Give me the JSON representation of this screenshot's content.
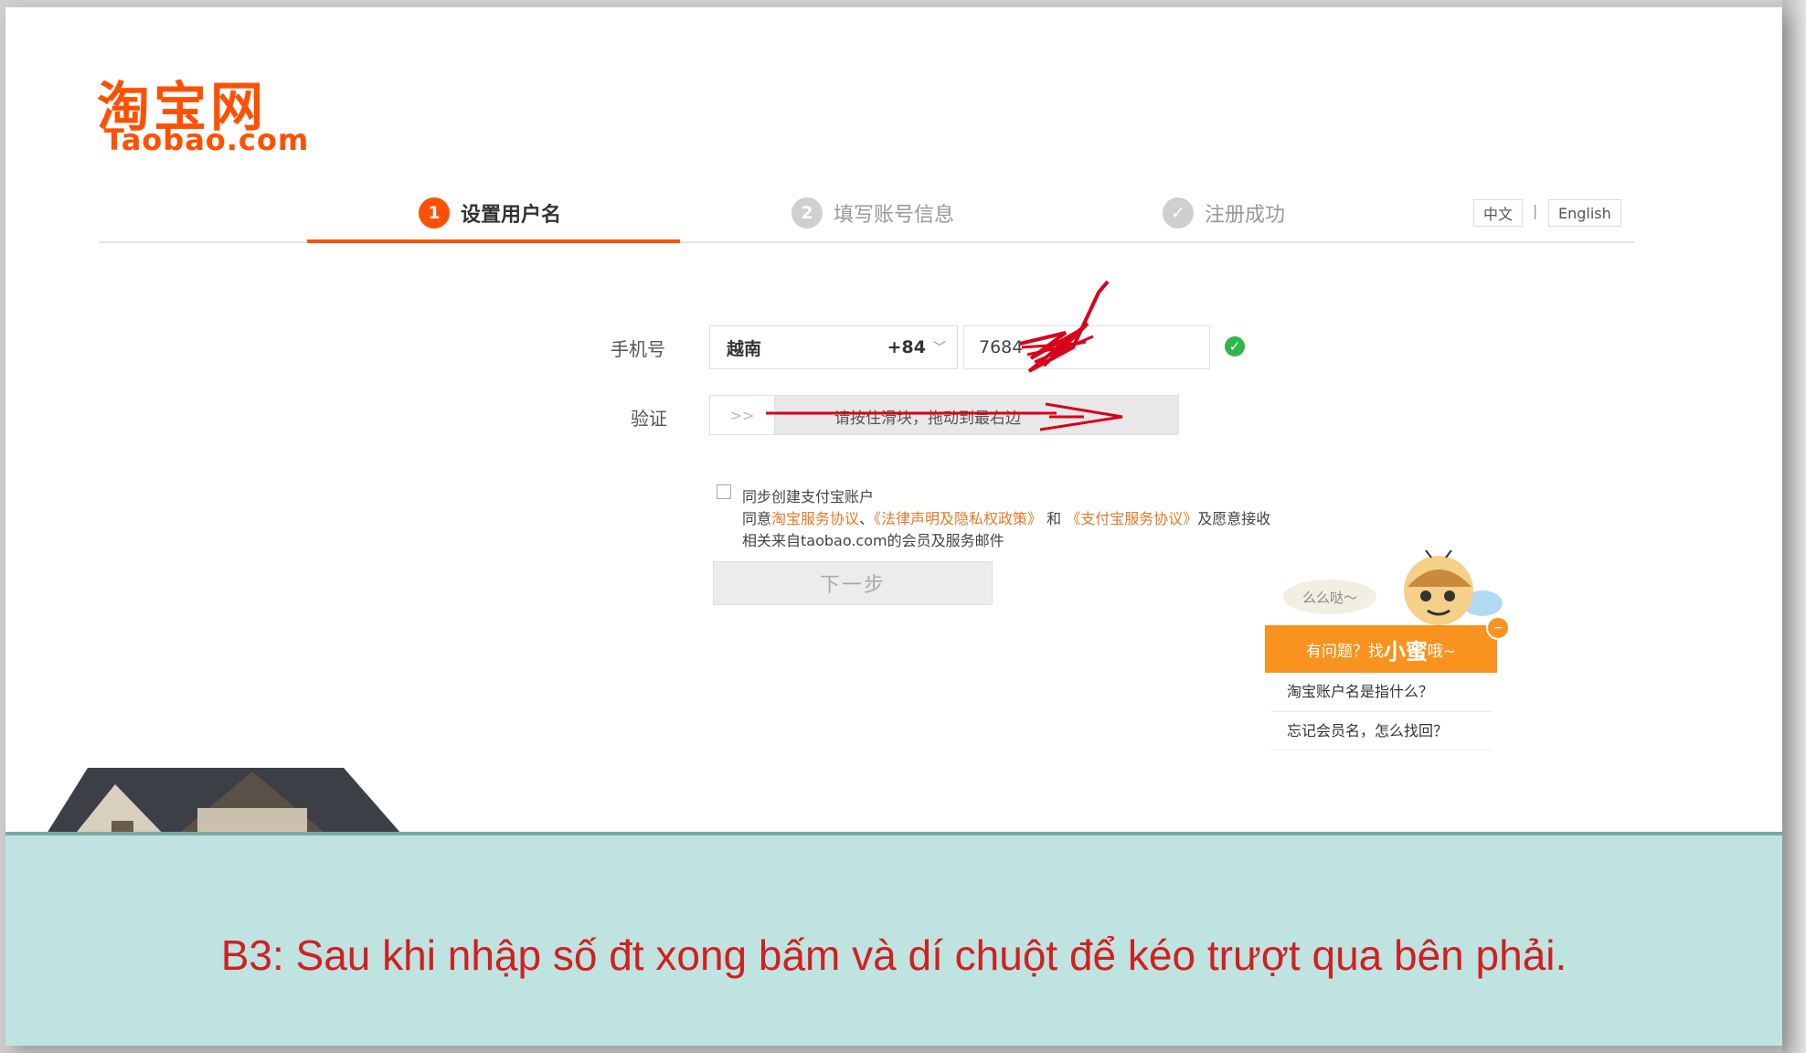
{
  "logo": {
    "chinese": "淘宝网",
    "english": "Taobao.com"
  },
  "steps": [
    {
      "number": "1",
      "label": "设置用户名",
      "active": true
    },
    {
      "number": "2",
      "label": "填写账号信息",
      "active": false
    },
    {
      "number": "✓",
      "label": "注册成功",
      "active": false
    }
  ],
  "language": {
    "chinese": "中文",
    "separator": "|",
    "english": "English"
  },
  "form": {
    "phone_label": "手机号",
    "country_name": "越南",
    "country_code": "+84",
    "phone_value": "7684",
    "verify_label": "验证",
    "slider_handle": ">>",
    "slider_text": "请按住滑块，拖动到最右边",
    "checkbox_label": "同步创建支付宝账户",
    "agree_prefix": "同意",
    "agree_link1": "淘宝服务协议",
    "agree_sep": "、",
    "agree_link2": "《法律声明及隐私权政策》",
    "agree_and": " 和 ",
    "agree_link3": "《支付宝服务协议》",
    "agree_suffix": "及愿意接收",
    "agree_line3": "相关来自taobao.com的会员及服务邮件",
    "next_button": "下一步"
  },
  "helper": {
    "bubble": "么么哒～",
    "header_prefix": "有问题？找",
    "header_name": "小蜜",
    "header_suffix": "哦~",
    "close": "−",
    "items": [
      "淘宝账户名是指什么？",
      "忘记会员名，怎么找回？"
    ]
  },
  "caption": "B3: Sau khi nhập số đt xong bấm và dí chuột để kéo trượt qua bên phải.",
  "colors": {
    "brand": "#ff5000",
    "accent_orange": "#f7931e",
    "caption_bg": "#bfe3e0",
    "caption_text": "#d02020",
    "success": "#31b64a"
  }
}
